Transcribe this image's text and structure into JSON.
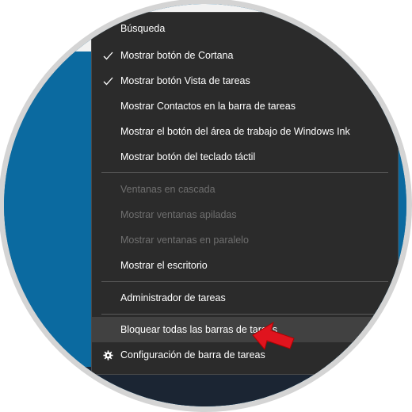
{
  "context_menu": {
    "items": [
      {
        "label": "Búsqueda",
        "checked": false,
        "disabled": false
      },
      {
        "label": "Mostrar botón de Cortana",
        "checked": true,
        "disabled": false
      },
      {
        "label": "Mostrar botón Vista de tareas",
        "checked": true,
        "disabled": false
      },
      {
        "label": "Mostrar Contactos en la barra de tareas",
        "checked": false,
        "disabled": false
      },
      {
        "label": "Mostrar el botón del área de trabajo de Windows Ink",
        "checked": false,
        "disabled": false
      },
      {
        "label": "Mostrar botón del teclado táctil",
        "checked": false,
        "disabled": false
      },
      {
        "label": "Ventanas en cascada",
        "checked": false,
        "disabled": true
      },
      {
        "label": "Mostrar ventanas apiladas",
        "checked": false,
        "disabled": true
      },
      {
        "label": "Mostrar ventanas en paralelo",
        "checked": false,
        "disabled": true
      },
      {
        "label": "Mostrar el escritorio",
        "checked": false,
        "disabled": false
      },
      {
        "label": "Administrador de tareas",
        "checked": false,
        "disabled": false
      },
      {
        "label": "Bloquear todas las barras de tareas",
        "checked": false,
        "disabled": false,
        "highlighted": true
      },
      {
        "label": "Configuración de barra de tareas",
        "checked": false,
        "disabled": false,
        "icon": "gear-icon"
      }
    ]
  },
  "colors": {
    "menu_background": "#2b2b2b",
    "menu_text": "#ffffff",
    "disabled_text": "#6f6f6f",
    "highlight": "#414141",
    "desktop": "#0b6aa0",
    "pointer_arrow": "#e0141e"
  }
}
